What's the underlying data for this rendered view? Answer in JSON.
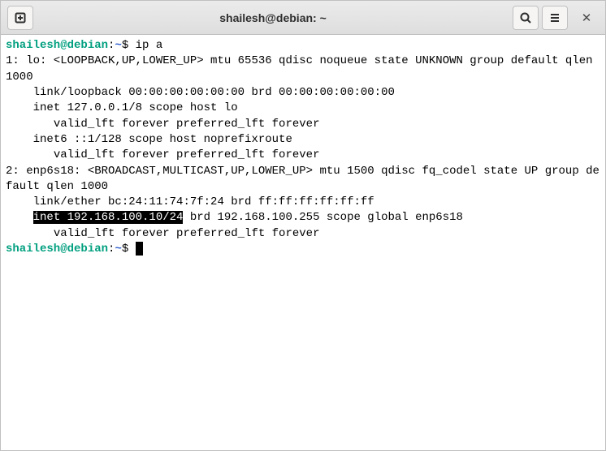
{
  "titlebar": {
    "title": "shailesh@debian: ~"
  },
  "prompt": {
    "user_host": "shailesh@debian",
    "separator": ":",
    "path": "~",
    "symbol": "$"
  },
  "command": "ip a",
  "output": {
    "l1": "1: lo: <LOOPBACK,UP,LOWER_UP> mtu 65536 qdisc noqueue state UNKNOWN group default qlen 1000",
    "l2": "    link/loopback 00:00:00:00:00:00 brd 00:00:00:00:00:00",
    "l3": "    inet 127.0.0.1/8 scope host lo",
    "l4": "       valid_lft forever preferred_lft forever",
    "l5": "    inet6 ::1/128 scope host noprefixroute",
    "l6": "       valid_lft forever preferred_lft forever",
    "l7": "2: enp6s18: <BROADCAST,MULTICAST,UP,LOWER_UP> mtu 1500 qdisc fq_codel state UP group default qlen 1000",
    "l8": "    link/ether bc:24:11:74:7f:24 brd ff:ff:ff:ff:ff:ff",
    "l9a": "    ",
    "l9_hl": "inet 192.168.100.10/24",
    "l9b": " brd 192.168.100.255 scope global enp6s18",
    "l10": "       valid_lft forever preferred_lft forever"
  }
}
